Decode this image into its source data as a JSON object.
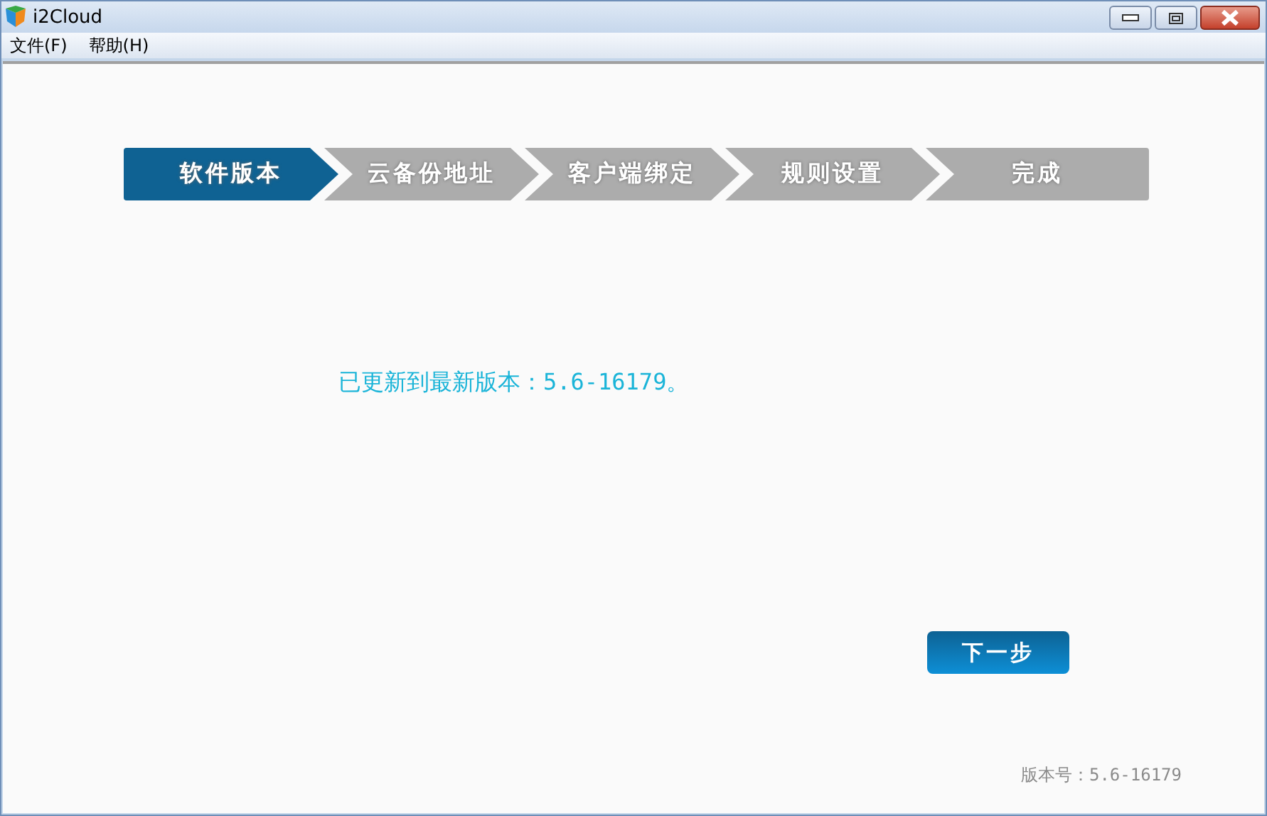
{
  "window": {
    "title": "i2Cloud"
  },
  "menu": [
    "文件(F)",
    "帮助(H)"
  ],
  "steps": [
    {
      "label": "软件版本",
      "selected": true
    },
    {
      "label": "云备份地址",
      "selected": false
    },
    {
      "label": "客户端绑定",
      "selected": false
    },
    {
      "label": "规则设置",
      "selected": false
    },
    {
      "label": "完成",
      "selected": false
    }
  ],
  "message": "已更新到最新版本：5.6-16179。",
  "next_button": "下一步",
  "version": "版本号：5.6-16179"
}
